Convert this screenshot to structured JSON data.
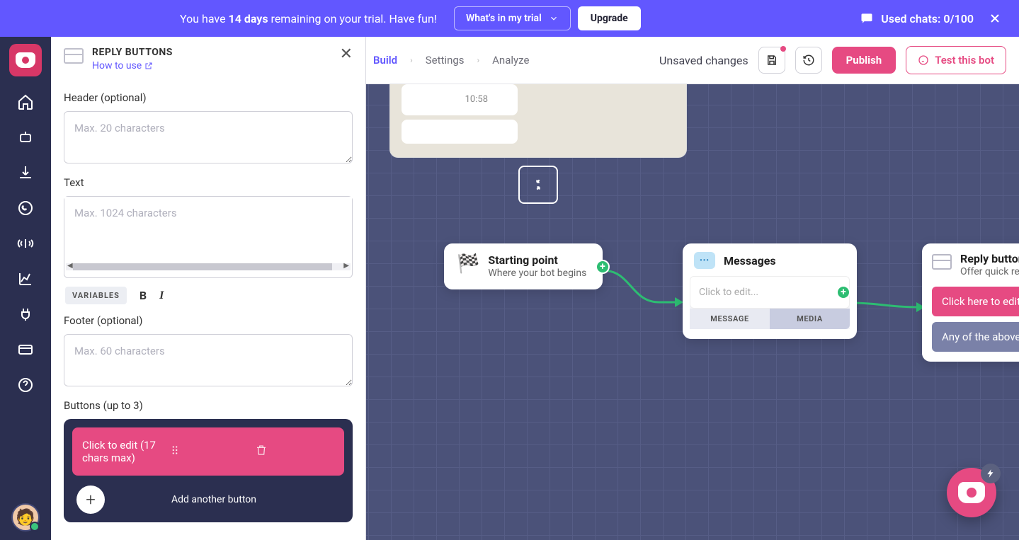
{
  "banner": {
    "text_pre": "You have ",
    "days": "14 days",
    "text_post": " remaining on your trial. Have fun!",
    "trial_btn": "What's in my trial",
    "upgrade_btn": "Upgrade",
    "used_chats_label": "Used chats: ",
    "used_chats_value": "0/100"
  },
  "topbar": {
    "tab_build": "Build",
    "tab_settings": "Settings",
    "tab_analyze": "Analyze",
    "unsaved": "Unsaved changes",
    "publish": "Publish",
    "test": "Test this bot"
  },
  "panel": {
    "title": "REPLY BUTTONS",
    "howto": "How to use",
    "header_label": "Header (optional)",
    "header_placeholder": "Max. 20 characters",
    "text_label": "Text",
    "text_placeholder": "Max. 1024 characters",
    "variables": "VARIABLES",
    "footer_label": "Footer (optional)",
    "footer_placeholder": "Max. 60 characters",
    "buttons_label": "Buttons (up to 3)",
    "button1_text": "Click to edit (17 chars max)",
    "add_another": "Add another button"
  },
  "preview": {
    "time": "10:58"
  },
  "nodes": {
    "start": {
      "title": "Starting point",
      "sub": "Where your bot begins"
    },
    "messages": {
      "title": "Messages",
      "edit_placeholder": "Click to edit...",
      "tab_message": "MESSAGE",
      "tab_media": "MEDIA"
    },
    "reply": {
      "title": "Reply buttons",
      "sub": "Offer quick responses",
      "btn1": "Click here to edit",
      "btn2": "Any of the above"
    }
  }
}
